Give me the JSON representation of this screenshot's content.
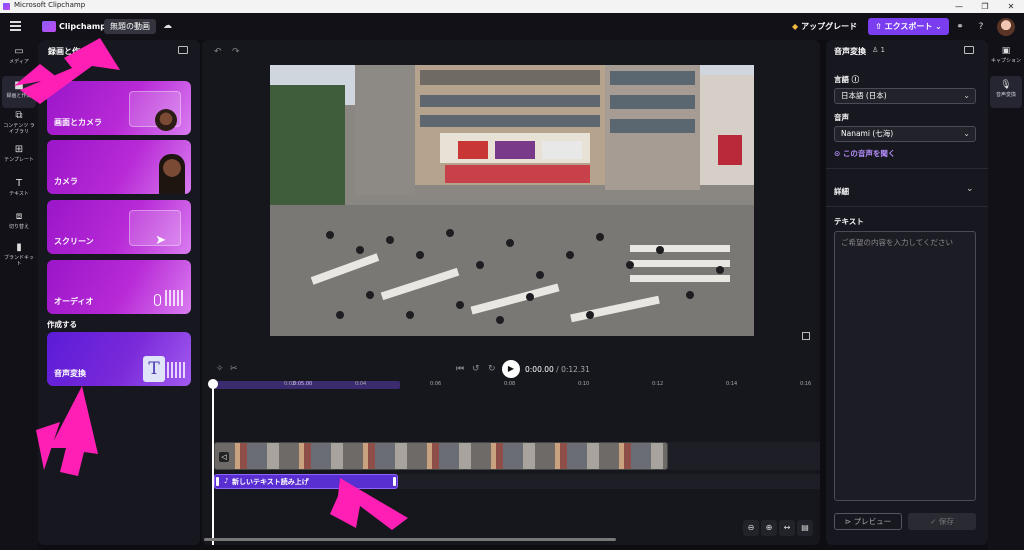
{
  "window": {
    "title": "Microsoft Clipchamp",
    "minimize": "—",
    "maximize": "❐",
    "close": "✕"
  },
  "header": {
    "app_name": "Clipchamp",
    "project_title": "無題の動画",
    "upgrade_label": "アップグレード",
    "export_label": "エクスポート",
    "help": "?"
  },
  "left_rail": {
    "items": [
      {
        "label": "メディア",
        "icon": "folder-icon"
      },
      {
        "label": "録画と作成",
        "icon": "camera-icon",
        "active": true
      },
      {
        "label": "コンテンツ ライブラリ",
        "icon": "library-icon"
      },
      {
        "label": "テンプレート",
        "icon": "template-icon"
      },
      {
        "label": "テキスト",
        "icon": "text-icon"
      },
      {
        "label": "切り替え",
        "icon": "transition-icon"
      },
      {
        "label": "ブランドキット",
        "icon": "brand-kit-icon"
      }
    ]
  },
  "left_panel": {
    "title": "録画と作成",
    "cards": [
      {
        "label": "画面とカメラ"
      },
      {
        "label": "カメラ"
      },
      {
        "label": "スクリーン"
      },
      {
        "label": "オーディオ"
      }
    ],
    "section_create": "作成する",
    "tts_card": {
      "label": "音声変換",
      "glyph": "T"
    }
  },
  "timeline": {
    "current": "0:00.00",
    "total": "/ 0:12.31",
    "ticks": [
      "0:02",
      "0:04",
      "0:06",
      "0:08",
      "0:10",
      "0:12",
      "0:14",
      "0:16"
    ],
    "playhead_tag": "0:05.00",
    "tts_clip_label": "新しいテキスト読み上げ"
  },
  "right_panel": {
    "title": "音声変換",
    "count": "1",
    "language_label": "言語",
    "language_value": "日本語 (日本)",
    "voice_label": "音声",
    "voice_value": "Nanami (七海)",
    "listen_label": "この音声を聞く",
    "details_label": "詳細",
    "text_label": "テキスト",
    "text_placeholder": "ご希望の内容を入力してください",
    "preview_label": "プレビュー",
    "save_label": "保存"
  },
  "right_rail": {
    "items": [
      {
        "label": "キャプション",
        "icon": "captions-icon"
      },
      {
        "label": "音声変換",
        "icon": "tts-icon",
        "active": true
      }
    ]
  },
  "colors": {
    "accent": "#7b3df0",
    "annotation": "#ff1fb4",
    "upgrade_gem": "#f5b942"
  }
}
